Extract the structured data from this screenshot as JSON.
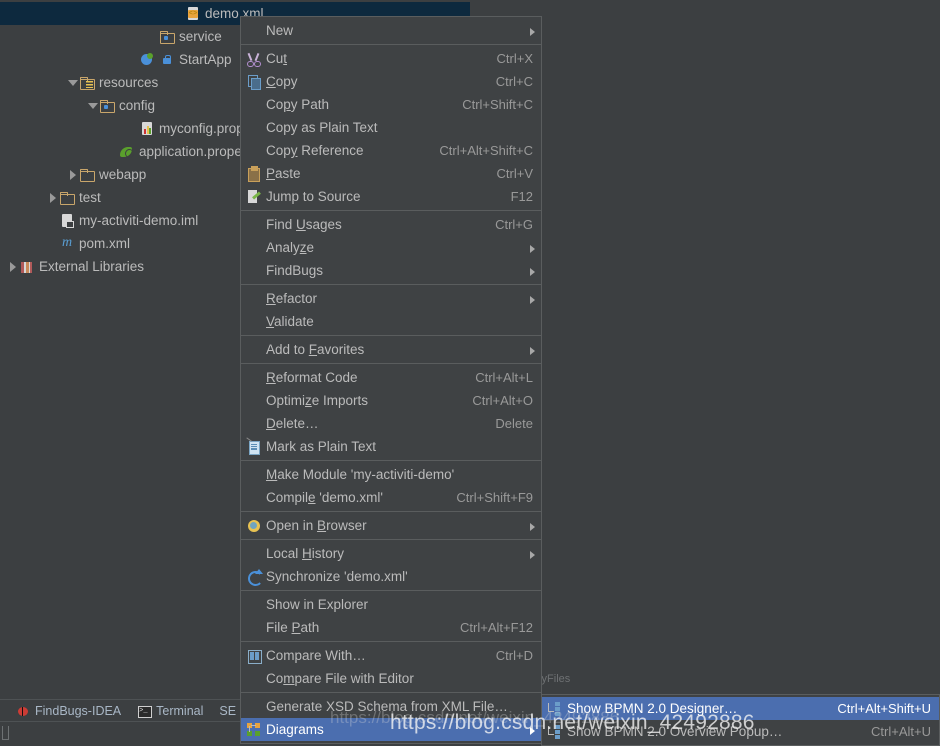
{
  "project_tree": {
    "rows": [
      {
        "label": "demo.xml",
        "icon": "xml-file-icon",
        "indent": 172,
        "twisty": "none",
        "selected": true
      },
      {
        "label": "service",
        "icon": "source-folder-icon",
        "indent": 146,
        "twisty": "none",
        "selected": false
      },
      {
        "label": "StartApp",
        "icon": "java-class-icon",
        "indent": 126,
        "twisty": "none",
        "selected": false
      },
      {
        "label": "resources",
        "icon": "resources-folder-icon",
        "indent": 66,
        "twisty": "down",
        "selected": false
      },
      {
        "label": "config",
        "icon": "source-folder-icon",
        "indent": 86,
        "twisty": "down",
        "selected": false
      },
      {
        "label": "myconfig.properties",
        "icon": "properties-file-icon",
        "indent": 126,
        "twisty": "none",
        "selected": false
      },
      {
        "label": "application.properties",
        "icon": "spring-properties-icon",
        "indent": 106,
        "twisty": "none",
        "selected": false
      },
      {
        "label": "webapp",
        "icon": "folder-icon",
        "indent": 66,
        "twisty": "right",
        "selected": false
      },
      {
        "label": "test",
        "icon": "folder-icon",
        "indent": 46,
        "twisty": "right",
        "selected": false
      },
      {
        "label": "my-activiti-demo.iml",
        "icon": "iml-file-icon",
        "indent": 46,
        "twisty": "none",
        "selected": false
      },
      {
        "label": "pom.xml",
        "icon": "maven-file-icon",
        "indent": 46,
        "twisty": "none",
        "selected": false
      },
      {
        "label": "External Libraries",
        "icon": "libraries-icon",
        "indent": 6,
        "twisty": "right",
        "selected": false
      }
    ]
  },
  "context_menu": {
    "items": [
      {
        "type": "item",
        "label": "New",
        "shortcut": "",
        "icon": "",
        "submenu": true,
        "selected": false
      },
      {
        "type": "sep"
      },
      {
        "type": "item",
        "label": "Cut",
        "mnemonic": "t",
        "shortcut": "Ctrl+X",
        "icon": "cut-icon",
        "submenu": false,
        "selected": false
      },
      {
        "type": "item",
        "label": "Copy",
        "mnemonic": "C",
        "shortcut": "Ctrl+C",
        "icon": "copy-icon",
        "submenu": false,
        "selected": false
      },
      {
        "type": "item",
        "label": "Copy Path",
        "mnemonic": "p",
        "shortcut": "Ctrl+Shift+C",
        "icon": "",
        "submenu": false,
        "selected": false
      },
      {
        "type": "item",
        "label": "Copy as Plain Text",
        "shortcut": "",
        "icon": "",
        "submenu": false,
        "selected": false
      },
      {
        "type": "item",
        "label": "Copy Reference",
        "mnemonic": "y",
        "shortcut": "Ctrl+Alt+Shift+C",
        "icon": "",
        "submenu": false,
        "selected": false
      },
      {
        "type": "item",
        "label": "Paste",
        "mnemonic": "P",
        "shortcut": "Ctrl+V",
        "icon": "paste-icon",
        "submenu": false,
        "selected": false
      },
      {
        "type": "item",
        "label": "Jump to Source",
        "shortcut": "F12",
        "icon": "jump-to-source-icon",
        "submenu": false,
        "selected": false
      },
      {
        "type": "sep"
      },
      {
        "type": "item",
        "label": "Find Usages",
        "mnemonic": "U",
        "shortcut": "Ctrl+G",
        "icon": "",
        "submenu": false,
        "selected": false
      },
      {
        "type": "item",
        "label": "Analyze",
        "mnemonic": "z",
        "shortcut": "",
        "icon": "",
        "submenu": true,
        "selected": false
      },
      {
        "type": "item",
        "label": "FindBugs",
        "shortcut": "",
        "icon": "",
        "submenu": true,
        "selected": false
      },
      {
        "type": "sep"
      },
      {
        "type": "item",
        "label": "Refactor",
        "mnemonic": "R",
        "shortcut": "",
        "icon": "",
        "submenu": true,
        "selected": false
      },
      {
        "type": "item",
        "label": "Validate",
        "mnemonic": "V",
        "shortcut": "",
        "icon": "",
        "submenu": false,
        "selected": false
      },
      {
        "type": "sep"
      },
      {
        "type": "item",
        "label": "Add to Favorites",
        "mnemonic": "F",
        "shortcut": "",
        "icon": "",
        "submenu": true,
        "selected": false
      },
      {
        "type": "sep"
      },
      {
        "type": "item",
        "label": "Reformat Code",
        "mnemonic": "R",
        "shortcut": "Ctrl+Alt+L",
        "icon": "",
        "submenu": false,
        "selected": false
      },
      {
        "type": "item",
        "label": "Optimize Imports",
        "mnemonic": "z",
        "shortcut": "Ctrl+Alt+O",
        "icon": "",
        "submenu": false,
        "selected": false
      },
      {
        "type": "item",
        "label": "Delete…",
        "mnemonic": "D",
        "shortcut": "Delete",
        "icon": "",
        "submenu": false,
        "selected": false
      },
      {
        "type": "item",
        "label": "Mark as Plain Text",
        "shortcut": "",
        "icon": "mark-as-plain-text-icon",
        "submenu": false,
        "selected": false
      },
      {
        "type": "sep"
      },
      {
        "type": "item",
        "label": "Make Module 'my-activiti-demo'",
        "mnemonic": "M",
        "shortcut": "",
        "icon": "",
        "submenu": false,
        "selected": false
      },
      {
        "type": "item",
        "label": "Compile 'demo.xml'",
        "mnemonic": "e",
        "shortcut": "Ctrl+Shift+F9",
        "icon": "",
        "submenu": false,
        "selected": false
      },
      {
        "type": "sep"
      },
      {
        "type": "item",
        "label": "Open in Browser",
        "mnemonic": "B",
        "shortcut": "",
        "icon": "browser-globe-icon",
        "submenu": true,
        "selected": false
      },
      {
        "type": "sep"
      },
      {
        "type": "item",
        "label": "Local History",
        "mnemonic": "H",
        "shortcut": "",
        "icon": "",
        "submenu": true,
        "selected": false
      },
      {
        "type": "item",
        "label": "Synchronize 'demo.xml'",
        "shortcut": "",
        "icon": "synchronize-icon",
        "submenu": false,
        "selected": false
      },
      {
        "type": "sep"
      },
      {
        "type": "item",
        "label": "Show in Explorer",
        "shortcut": "",
        "icon": "",
        "submenu": false,
        "selected": false
      },
      {
        "type": "item",
        "label": "File Path",
        "mnemonic": "P",
        "shortcut": "Ctrl+Alt+F12",
        "icon": "",
        "submenu": false,
        "selected": false
      },
      {
        "type": "sep"
      },
      {
        "type": "item",
        "label": "Compare With…",
        "shortcut": "Ctrl+D",
        "icon": "compare-icon",
        "submenu": false,
        "selected": false
      },
      {
        "type": "item",
        "label": "Compare File with Editor",
        "mnemonic": "m",
        "shortcut": "",
        "icon": "",
        "submenu": false,
        "selected": false
      },
      {
        "type": "sep"
      },
      {
        "type": "item",
        "label": "Generate XSD Schema from XML File…",
        "shortcut": "",
        "icon": "",
        "submenu": false,
        "selected": false
      },
      {
        "type": "item",
        "label": "Diagrams",
        "shortcut": "",
        "icon": "diagrams-icon",
        "submenu": true,
        "selected": true
      }
    ]
  },
  "submenu": {
    "items": [
      {
        "label": "Show BPMN 2.0 Designer…",
        "shortcut": "Ctrl+Alt+Shift+U",
        "icon": "bpmn-designer-icon",
        "selected": true
      },
      {
        "label": "Show BPMN 2.0 Overview Popup…",
        "shortcut": "Ctrl+Alt+U",
        "icon": "bpmn-overview-icon",
        "selected": false
      }
    ]
  },
  "labels": {
    "yfiles": "y yFiles"
  },
  "status_bar": {
    "items": [
      {
        "label": "FindBugs-IDEA",
        "icon": "findbugs-icon"
      },
      {
        "label": "Terminal",
        "icon": "terminal-icon"
      },
      {
        "label": "SE",
        "icon": ""
      }
    ]
  },
  "watermark": {
    "url": "https://blog.csdn.net/weixin_42492886",
    "ghost": "https://blog.csdn.net/weixin_42492886"
  },
  "colors": {
    "background": "#3c3f41",
    "menu_background": "#3f4244",
    "menu_border": "#5a5d5e",
    "selection_blue": "#4b6eaf",
    "tree_selection": "#0d293e",
    "text": "#bbbbbb",
    "shortcut_text": "#999999"
  }
}
